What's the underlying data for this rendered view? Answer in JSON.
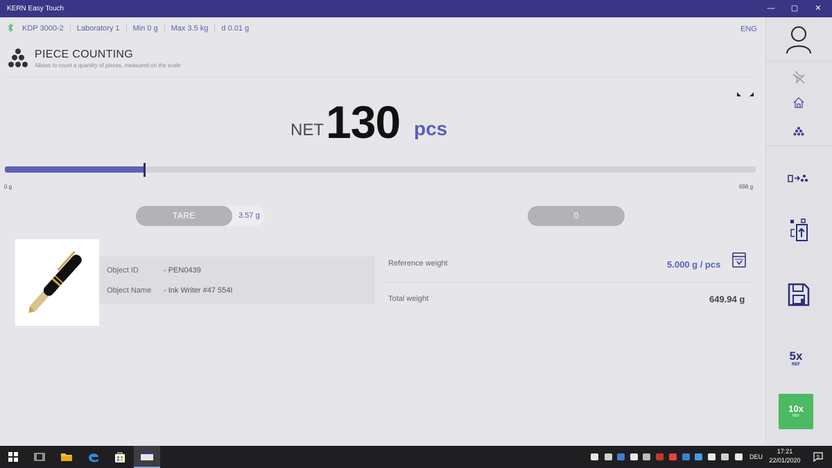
{
  "window": {
    "title": "KERN Easy Touch",
    "controls": [
      "—",
      "▢",
      "✕"
    ]
  },
  "info_bar": {
    "model": "KDP 3000-2",
    "location": "Laboratory 1",
    "min": "Min 0 g",
    "max": "Max 3.5 kg",
    "d": "d 0.01 g",
    "language": "ENG"
  },
  "header": {
    "title": "PIECE COUNTING",
    "subtitle": "Allows to count a quantity of pieces, measured on the scale"
  },
  "display": {
    "mode_label": "NET",
    "value": "130",
    "unit": "pcs"
  },
  "range_bar": {
    "min_label": "0 g",
    "max_label": "698 g",
    "fill_fraction": 0.186
  },
  "tare": {
    "label": "TARE",
    "value": "3.57 g"
  },
  "zero": {
    "label": "0"
  },
  "object": {
    "id_label": "Object ID",
    "id_value": "- PEN0439",
    "name_label": "Object Name",
    "name_value": "- Ink Writer #47 554I"
  },
  "reference": {
    "label": "Reference weight",
    "value": "5.000 g / pcs"
  },
  "total": {
    "label": "Total weight",
    "value": "649.94 g"
  },
  "sidebar": {
    "ref5_num": "5x",
    "ref5_sub": "REF",
    "ref10_num": "10x",
    "ref10_sub": "REF"
  },
  "taskbar": {
    "language": "DEU",
    "time": "17:21",
    "date": "22/01/2020",
    "notifications": "5"
  },
  "colors": {
    "accent": "#5d62b8",
    "titlebar": "#3a3585",
    "ok_green": "#4cba62",
    "background": "#e6e6ea"
  }
}
